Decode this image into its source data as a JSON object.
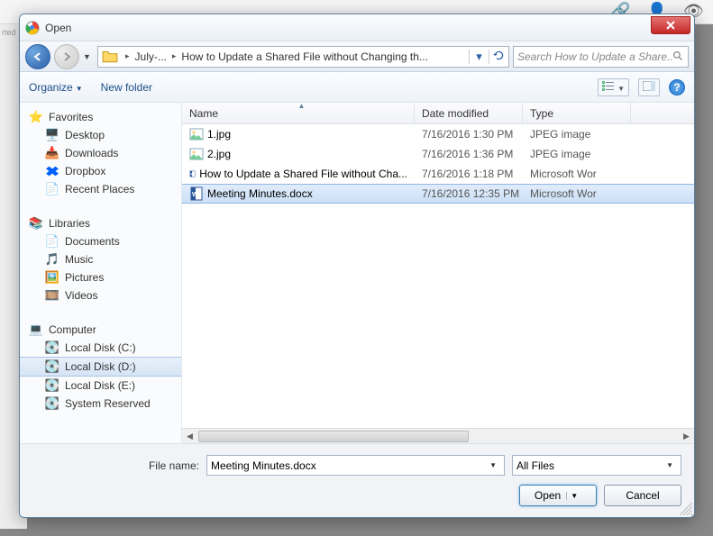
{
  "dialog": {
    "title": "Open",
    "close": "✕"
  },
  "nav": {
    "crumb1": "July-...",
    "crumb2": "How to Update a Shared File without Changing th...",
    "search_placeholder": "Search How to Update a Share..."
  },
  "toolbar": {
    "organize": "Organize",
    "newfolder": "New folder"
  },
  "sidebar": {
    "favorites": {
      "label": "Favorites",
      "items": [
        "Desktop",
        "Downloads",
        "Dropbox",
        "Recent Places"
      ]
    },
    "libraries": {
      "label": "Libraries",
      "items": [
        "Documents",
        "Music",
        "Pictures",
        "Videos"
      ]
    },
    "computer": {
      "label": "Computer",
      "items": [
        "Local Disk (C:)",
        "Local Disk (D:)",
        "Local Disk (E:)",
        "System Reserved"
      ]
    }
  },
  "columns": {
    "name": "Name",
    "date": "Date modified",
    "type": "Type"
  },
  "files": [
    {
      "name": "1.jpg",
      "date": "7/16/2016 1:30 PM",
      "type": "JPEG image",
      "icon": "img"
    },
    {
      "name": "2.jpg",
      "date": "7/16/2016 1:36 PM",
      "type": "JPEG image",
      "icon": "img"
    },
    {
      "name": "How to Update a Shared File without Cha...",
      "date": "7/16/2016 1:18 PM",
      "type": "Microsoft Wor",
      "icon": "doc"
    },
    {
      "name": "Meeting Minutes.docx",
      "date": "7/16/2016 12:35 PM",
      "type": "Microsoft Wor",
      "icon": "doc",
      "selected": true
    }
  ],
  "bottom": {
    "filename_label": "File name:",
    "filename_value": "Meeting Minutes.docx",
    "filter": "All Files",
    "open": "Open",
    "cancel": "Cancel"
  }
}
